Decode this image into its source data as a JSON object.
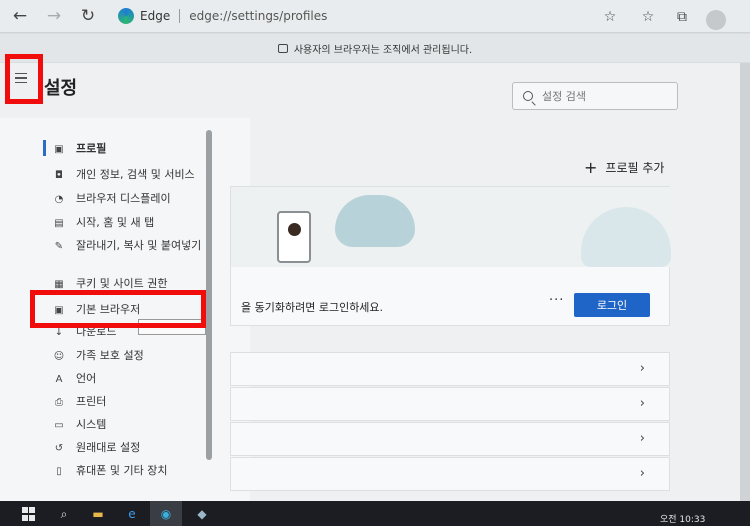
{
  "browser": {
    "app_name": "Edge",
    "url": "edge://settings/profiles"
  },
  "notice": {
    "text": "사용자의 브라우저는 조직에서 관리됩니다."
  },
  "header": {
    "title": "설정",
    "search_placeholder": "설정 검색"
  },
  "sidebar": {
    "items": [
      {
        "label": "프로필",
        "icon": "profile-icon"
      },
      {
        "label": "개인 정보, 검색 및 서비스",
        "icon": "lock-icon"
      },
      {
        "label": "브라우저 디스플레이",
        "icon": "appearance-icon"
      },
      {
        "label": "시작, 홈 및 새 탭",
        "icon": "start-icon"
      },
      {
        "label": "잘라내기, 복사 및 붙여넣기",
        "icon": "clipboard-icon"
      },
      {
        "label": "쿠키 및 사이트 권한",
        "icon": "cookie-icon"
      },
      {
        "label": "기본 브라우저",
        "icon": "browser-icon"
      },
      {
        "label": "다운로드",
        "icon": "download-icon"
      },
      {
        "label": "가족 보호 설정",
        "icon": "family-icon"
      },
      {
        "label": "언어",
        "icon": "language-icon"
      },
      {
        "label": "프린터",
        "icon": "printer-icon"
      },
      {
        "label": "시스템",
        "icon": "system-icon"
      },
      {
        "label": "원래대로 설정",
        "icon": "reset-icon"
      },
      {
        "label": "휴대폰 및 기타 장치",
        "icon": "phone-icon"
      }
    ]
  },
  "main": {
    "add_profile_label": "프로필 추가",
    "sync_text": "을 동기화하려면 로그인하세요.",
    "more_label": "···",
    "login_label": "로그인"
  },
  "taskbar": {
    "time": "오전 10:33"
  },
  "colors": {
    "accent": "#1f64c7",
    "highlight": "#f20d0d"
  }
}
